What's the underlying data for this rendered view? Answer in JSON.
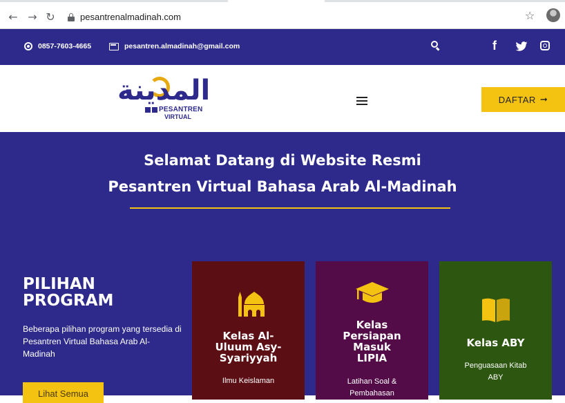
{
  "browser": {
    "url": "pesantrenalmadinah.com",
    "icons": [
      "back-icon",
      "forward-icon",
      "reload-icon",
      "lock-icon",
      "star-icon",
      "profile-avatar"
    ]
  },
  "topbar": {
    "phone": "0857-7603-4665",
    "email": "pesantren.almadinah@gmail.com",
    "icons": [
      "whatsapp-icon",
      "mail-icon",
      "search-icon",
      "facebook-icon",
      "twitter-icon",
      "instagram-icon"
    ]
  },
  "header": {
    "logo_arabic": "المدينة",
    "logo_sub1": "PESANTREN",
    "logo_sub2": "VIRTUAL",
    "daftar_label": "DAFTAR",
    "daftar_arrow": "➞"
  },
  "hero": {
    "title_line1": "Selamat Datang di Website Resmi",
    "title_line2": "Pesantren Virtual Bahasa Arab Al-Madinah"
  },
  "program": {
    "title_line1": "PILIHAN",
    "title_line2": "PROGRAM",
    "desc": "Beberapa pilihan program yang tersedia di Pesantren Virtual Bahasa Arab Al-Madinah",
    "button": "Lihat Semua"
  },
  "cards": [
    {
      "title_lines": [
        "Kelas Al-",
        "Uluum Asy-",
        "Syariyyah"
      ],
      "desc_lines": [
        "Ilmu Keislaman"
      ],
      "icon": "mosque-icon",
      "color": "#5b0e14"
    },
    {
      "title_lines": [
        "Kelas",
        "Persiapan",
        "Masuk",
        "LIPIA"
      ],
      "desc_lines": [
        "Latihan Soal &",
        "Pembahasan"
      ],
      "icon": "graduation-cap-icon",
      "color": "#530c48"
    },
    {
      "title_lines": [
        "Kelas ABY"
      ],
      "desc_lines": [
        "Penguasaan Kitab",
        "ABY"
      ],
      "icon": "book-icon",
      "color": "#2d5611"
    }
  ],
  "colors": {
    "primary": "#2e2a8c",
    "accent": "#f4c211"
  }
}
